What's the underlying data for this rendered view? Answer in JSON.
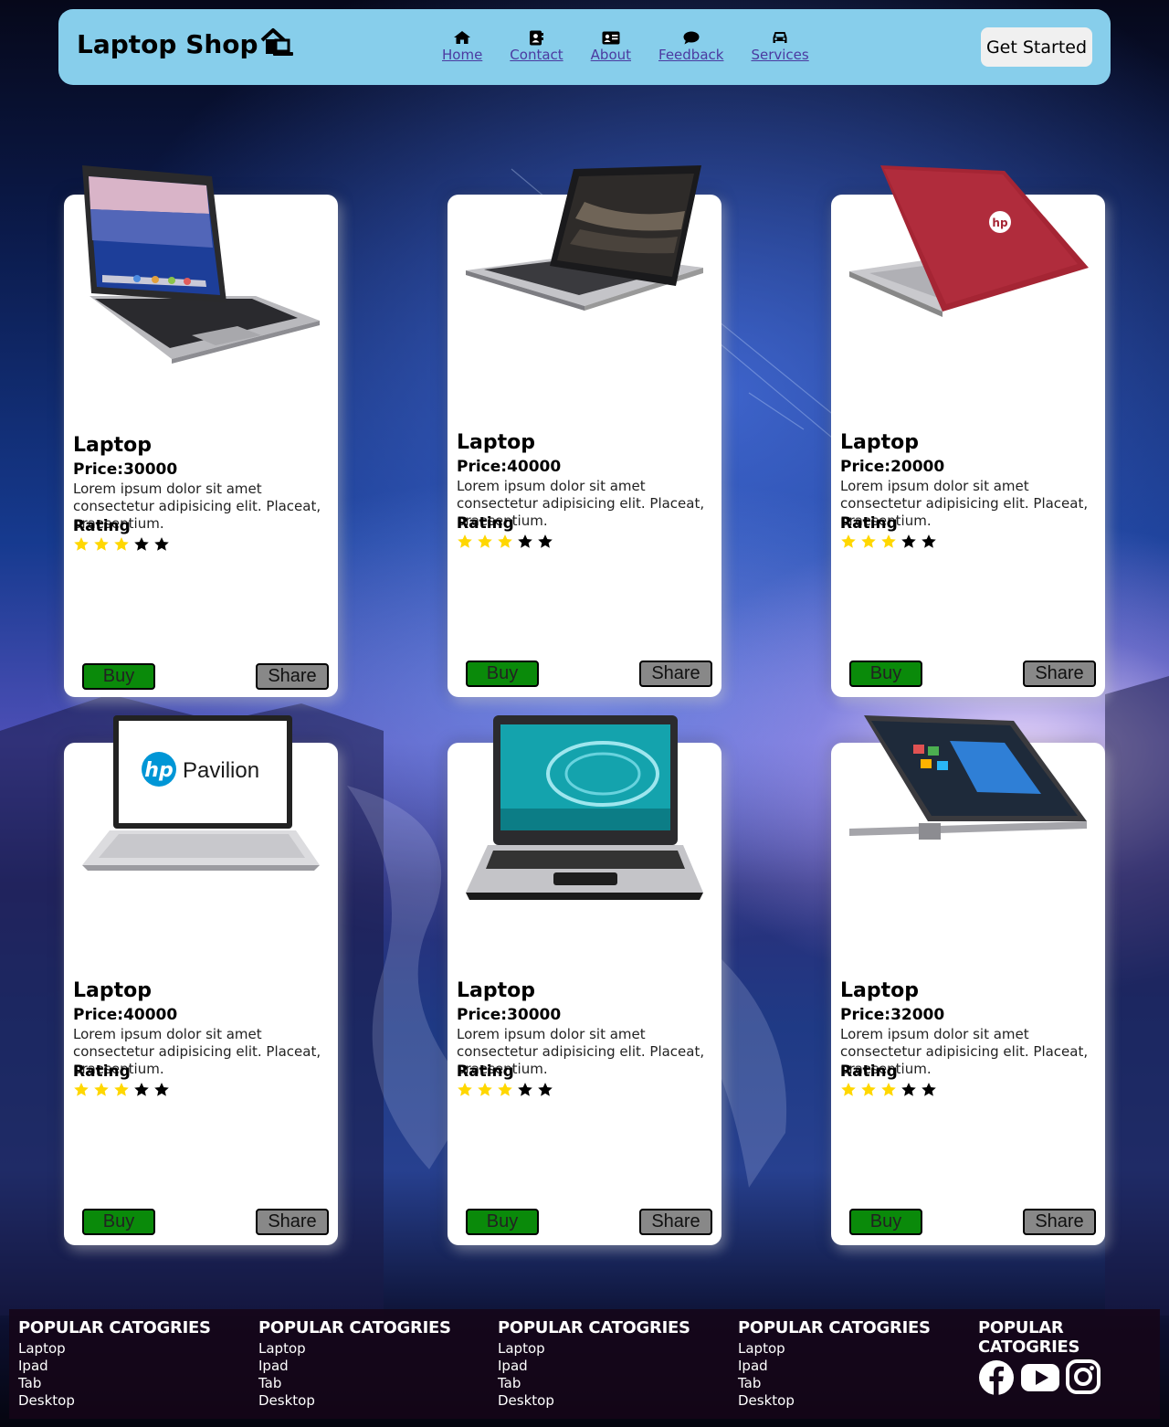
{
  "navbar": {
    "brand": "Laptop Shop",
    "links": [
      {
        "label": "Home",
        "icon": "home-icon"
      },
      {
        "label": "Contact",
        "icon": "address-book-icon"
      },
      {
        "label": "About",
        "icon": "id-card-icon"
      },
      {
        "label": "Feedback",
        "icon": "comment-icon"
      },
      {
        "label": "Services",
        "icon": "car-icon"
      }
    ],
    "cta": "Get Started"
  },
  "colors": {
    "nav_bg": "#87ceeb",
    "buy": "#0a8a0a",
    "share": "#888888",
    "star_filled": "#ffd700",
    "star_empty": "#000000"
  },
  "products": [
    {
      "title": "Laptop",
      "price": "Price:30000",
      "desc": "Lorem ipsum dolor sit amet consectetur adipisicing elit. Placeat, praesentium.",
      "rating_label": "Rating",
      "rating": 3,
      "rating_max": 5,
      "buy": "Buy",
      "share": "Share",
      "image": "silver-laptop"
    },
    {
      "title": "Laptop",
      "price": "Price:40000",
      "desc": "Lorem ipsum dolor sit amet consectetur adipisicing elit. Placeat, praesentium.",
      "rating_label": "Rating",
      "rating": 3,
      "rating_max": 5,
      "buy": "Buy",
      "share": "Share",
      "image": "hp-laptop"
    },
    {
      "title": "Laptop",
      "price": "Price:20000",
      "desc": "Lorem ipsum dolor sit amet consectetur adipisicing elit. Placeat, praesentium.",
      "rating_label": "Rating",
      "rating": 3,
      "rating_max": 5,
      "buy": "Buy",
      "share": "Share",
      "image": "red-hp-laptop"
    },
    {
      "title": "Laptop",
      "price": "Price:40000",
      "desc": "Lorem ipsum dolor sit amet consectetur adipisicing elit. Placeat, praesentium.",
      "rating_label": "Rating",
      "rating": 3,
      "rating_max": 5,
      "buy": "Buy",
      "share": "Share",
      "image": "hp-pavilion",
      "screen_text": "Pavilion"
    },
    {
      "title": "Laptop",
      "price": "Price:30000",
      "desc": "Lorem ipsum dolor sit amet consectetur adipisicing elit. Placeat, praesentium.",
      "rating_label": "Rating",
      "rating": 3,
      "rating_max": 5,
      "buy": "Buy",
      "share": "Share",
      "image": "hp-classic-laptop"
    },
    {
      "title": "Laptop",
      "price": "Price:32000",
      "desc": "Lorem ipsum dolor sit amet consectetur adipisicing elit. Placeat, praesentium.",
      "rating_label": "Rating",
      "rating": 3,
      "rating_max": 5,
      "buy": "Buy",
      "share": "Share",
      "image": "hp-x360-laptop"
    }
  ],
  "footer": {
    "columns": [
      {
        "heading": "POPULAR CATOGRIES",
        "links": [
          "Laptop",
          "Ipad",
          "Tab",
          "Desktop"
        ]
      },
      {
        "heading": "POPULAR CATOGRIES",
        "links": [
          "Laptop",
          "Ipad",
          "Tab",
          "Desktop"
        ]
      },
      {
        "heading": "POPULAR CATOGRIES",
        "links": [
          "Laptop",
          "Ipad",
          "Tab",
          "Desktop"
        ]
      },
      {
        "heading": "POPULAR CATOGRIES",
        "links": [
          "Laptop",
          "Ipad",
          "Tab",
          "Desktop"
        ]
      },
      {
        "heading": "POPULAR CATOGRIES",
        "social": [
          "facebook-icon",
          "youtube-icon",
          "instagram-icon"
        ]
      }
    ]
  }
}
